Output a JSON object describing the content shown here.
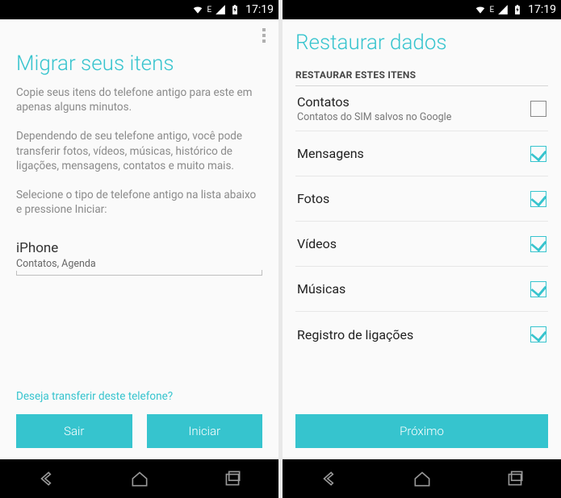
{
  "status": {
    "net_indicator": "E",
    "time": "17:19"
  },
  "left": {
    "title": "Migrar seus itens",
    "para1": "Copie seus itens do telefone antigo para este em apenas alguns minutos.",
    "para2": "Dependendo de seu telefone antigo, você pode transferir fotos, vídeos, músicas, histórico de ligações, mensagens, contatos e muito mais.",
    "para3": "Selecione o tipo de telefone antigo na lista abaixo e pressione Iniciar:",
    "selector": {
      "value": "iPhone",
      "sub": "Contatos, Agenda"
    },
    "link": "Deseja transferir deste telefone?",
    "btn_left": "Sair",
    "btn_right": "Iniciar"
  },
  "right": {
    "title": "Restaurar dados",
    "section": "RESTAURAR ESTES ITENS",
    "items": [
      {
        "label": "Contatos",
        "sub": "Contatos do SIM salvos no Google",
        "checked": false
      },
      {
        "label": "Mensagens",
        "sub": "",
        "checked": true
      },
      {
        "label": "Fotos",
        "sub": "",
        "checked": true
      },
      {
        "label": "Vídeos",
        "sub": "",
        "checked": true
      },
      {
        "label": "Músicas",
        "sub": "",
        "checked": true
      },
      {
        "label": "Registro de ligações",
        "sub": "",
        "checked": true
      }
    ],
    "btn": "Próximo"
  }
}
